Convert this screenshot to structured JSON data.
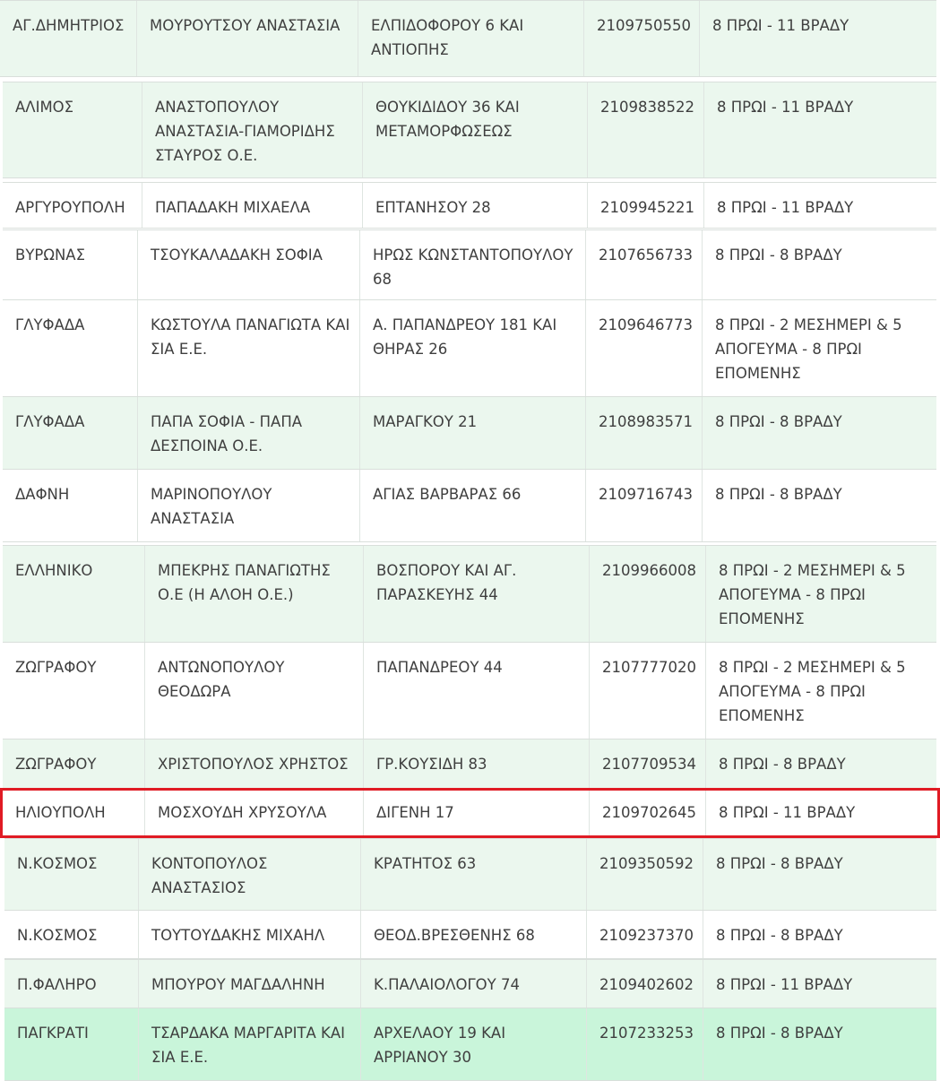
{
  "rows": [
    {
      "area": "ΑΓ.ΔΗΜΗΤΡΙΟΣ",
      "name": "ΜΟΥΡΟΥΤΣΟΥ ΑΝΑΣΤΑΣΙΑ",
      "address": "ΕΛΠΙΔΟΦΟΡΟΥ 6 ΚΑΙ ΑΝΤΙΟΠΗΣ",
      "phone": "2109750550",
      "hours": "8 ΠΡΩΙ - 11 ΒΡΑΔΥ"
    },
    {
      "area": "ΑΛΙΜΟΣ",
      "name": "ΑΝΑΣΤΟΠΟΥΛΟΥ ΑΝΑΣΤΑΣΙΑ-ΓΙΑΜΟΡΙΔΗΣ ΣΤΑΥΡΟΣ Ο.Ε.",
      "address": "ΘΟΥΚΙΔΙΔΟΥ 36 ΚΑΙ ΜΕΤΑΜΟΡΦΩΣΕΩΣ",
      "phone": "2109838522",
      "hours": "8 ΠΡΩΙ - 11 ΒΡΑΔΥ"
    },
    {
      "area": "ΑΡΓΥΡΟΥΠΟΛΗ",
      "name": "ΠΑΠΑΔΑΚΗ ΜΙΧΑΕΛΑ",
      "address": "ΕΠΤΑΝΗΣΟΥ 28",
      "phone": "2109945221",
      "hours": "8 ΠΡΩΙ - 11 ΒΡΑΔΥ"
    },
    {
      "area": "ΒΥΡΩΝΑΣ",
      "name": "ΤΣΟΥΚΑΛΑΔΑΚΗ ΣΟΦΙΑ",
      "address": "ΗΡΩΣ ΚΩΝΣΤΑΝΤΟΠΟΥΛΟΥ 68",
      "phone": "2107656733",
      "hours": "8 ΠΡΩΙ - 8 ΒΡΑΔΥ"
    },
    {
      "area": "ΓΛΥΦΑΔΑ",
      "name": "ΚΩΣΤΟΥΛΑ ΠΑΝΑΓΙΩΤΑ ΚΑΙ ΣΙΑ Ε.Ε.",
      "address": "Α. ΠΑΠΑΝΔΡΕΟΥ 181 ΚΑΙ ΘΗΡΑΣ 26",
      "phone": "2109646773",
      "hours": "8 ΠΡΩΙ - 2 ΜΕΣΗΜΕΡΙ & 5 ΑΠΟΓΕΥΜΑ - 8 ΠΡΩΙ ΕΠΟΜΕΝΗΣ"
    },
    {
      "area": "ΓΛΥΦΑΔΑ",
      "name": "ΠΑΠΑ ΣΟΦΙΑ - ΠΑΠΑ ΔΕΣΠΟΙΝΑ Ο.Ε.",
      "address": "ΜΑΡΑΓΚΟΥ 21",
      "phone": "2108983571",
      "hours": "8 ΠΡΩΙ - 8 ΒΡΑΔΥ"
    },
    {
      "area": "ΔΑΦΝΗ",
      "name": "ΜΑΡΙΝΟΠΟΥΛΟΥ ΑΝΑΣΤΑΣΙΑ",
      "address": "ΑΓΙΑΣ ΒΑΡΒΑΡΑΣ 66",
      "phone": "2109716743",
      "hours": "8 ΠΡΩΙ - 8 ΒΡΑΔΥ"
    },
    {
      "area": "ΕΛΛΗΝΙΚΟ",
      "name": "ΜΠΕΚΡΗΣ ΠΑΝΑΓΙΩΤΗΣ Ο.Ε (Η ΑΛΟΗ Ο.Ε.)",
      "address": "ΒΟΣΠΟΡΟΥ ΚΑΙ ΑΓ. ΠΑΡΑΣΚΕΥΗΣ 44",
      "phone": "2109966008",
      "hours": "8 ΠΡΩΙ - 2 ΜΕΣΗΜΕΡΙ & 5 ΑΠΟΓΕΥΜΑ - 8 ΠΡΩΙ ΕΠΟΜΕΝΗΣ"
    },
    {
      "area": "ΖΩΓΡΑΦΟΥ",
      "name": "ΑΝΤΩΝΟΠΟΥΛΟΥ ΘΕΟΔΩΡΑ",
      "address": "ΠΑΠΑΝΔΡΕΟΥ 44",
      "phone": "2107777020",
      "hours": "8 ΠΡΩΙ - 2 ΜΕΣΗΜΕΡΙ & 5 ΑΠΟΓΕΥΜΑ - 8 ΠΡΩΙ ΕΠΟΜΕΝΗΣ"
    },
    {
      "area": "ΖΩΓΡΑΦΟΥ",
      "name": "ΧΡΙΣΤΟΠΟΥΛΟΣ ΧΡΗΣΤΟΣ",
      "address": "ΓΡ.ΚΟΥΣΙΔΗ 83",
      "phone": "2107709534",
      "hours": "8 ΠΡΩΙ - 8 ΒΡΑΔΥ"
    },
    {
      "area": "ΗΛΙΟΥΠΟΛΗ",
      "name": "ΜΟΣΧΟΥΔΗ ΧΡΥΣΟΥΛΑ",
      "address": "ΔΙΓΕΝΗ 17",
      "phone": "2109702645",
      "hours": "8 ΠΡΩΙ - 11 ΒΡΑΔΥ"
    },
    {
      "area": "Ν.ΚΟΣΜΟΣ",
      "name": "ΚΟΝΤΟΠΟΥΛΟΣ ΑΝΑΣΤΑΣΙΟΣ",
      "address": "ΚΡΑΤΗΤΟΣ 63",
      "phone": "2109350592",
      "hours": "8 ΠΡΩΙ - 8 ΒΡΑΔΥ"
    },
    {
      "area": "Ν.ΚΟΣΜΟΣ",
      "name": "ΤΟΥΤΟΥΔΑΚΗΣ ΜΙΧΑΗΛ",
      "address": "ΘΕΟΔ.ΒΡΕΣΘΕΝΗΣ 68",
      "phone": "2109237370",
      "hours": "8 ΠΡΩΙ - 8 ΒΡΑΔΥ"
    },
    {
      "area": "Π.ΦΑΛΗΡΟ",
      "name": "ΜΠΟΥΡΟΥ ΜΑΓΔΑΛΗΝΗ",
      "address": "Κ.ΠΑΛΑΙΟΛΟΓΟΥ 74",
      "phone": "2109402602",
      "hours": "8 ΠΡΩΙ - 11 ΒΡΑΔΥ"
    },
    {
      "area": "ΠΑΓΚΡΑΤΙ",
      "name": "ΤΣΑΡΔΑΚΑ ΜΑΡΓΑΡΙΤΑ ΚΑΙ ΣΙΑ Ε.Ε.",
      "address": "ΑΡΧΕΛΑΟΥ 19 ΚΑΙ ΑΡΡΙΑΝΟΥ 30",
      "phone": "2107233253",
      "hours": "8 ΠΡΩΙ - 8 ΒΡΑΔΥ"
    }
  ],
  "highlighted_row_index": 10,
  "colors": {
    "row_green": "#ebf7ee",
    "row_white": "#ffffff",
    "row_bright": "#c9f5da",
    "highlight_border": "#e01b24",
    "text": "#3f3f3f"
  }
}
